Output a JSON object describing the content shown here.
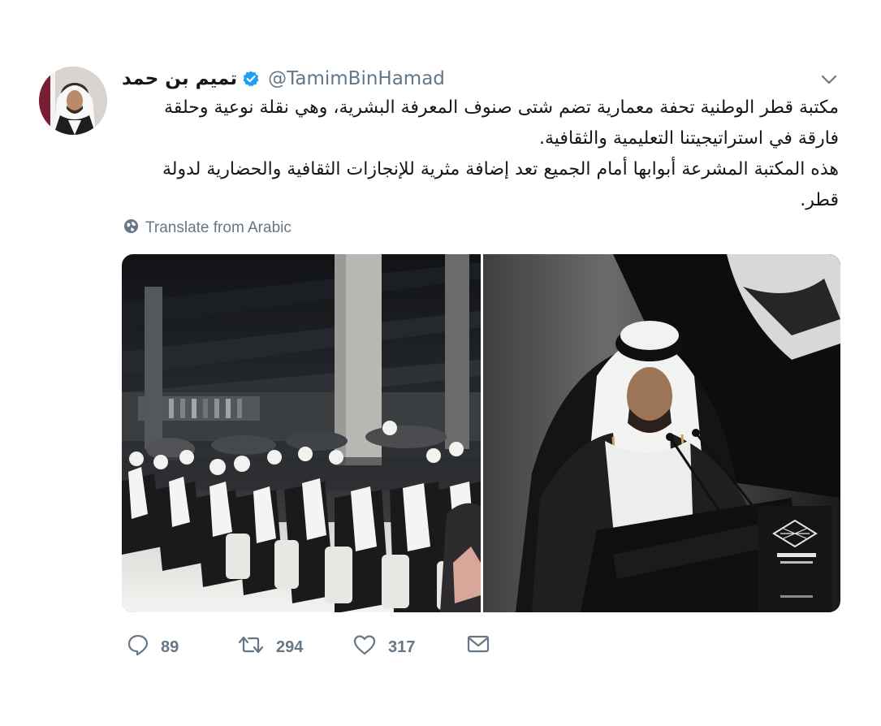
{
  "author": {
    "display_name": "تميم بن حمد",
    "handle": "@TamimBinHamad",
    "verified": true,
    "verified_color": "#1da1f2"
  },
  "tweet": {
    "paragraph_1": "مكتبة قطر الوطنية تحفة معمارية تضم شتى صنوف المعرفة البشرية، وهي نقلة نوعية وحلقة فارقة في استراتيجيتنا التعليمية والثقافية.",
    "paragraph_2": "هذه المكتبة المشرعة أبوابها أمام الجميع تعد إضافة مثرية للإنجازات الثقافية والحضارية لدولة قطر.",
    "translate_label": "Translate from Arabic"
  },
  "actions": {
    "reply_count": "89",
    "retweet_count": "294",
    "like_count": "317"
  },
  "icons": {
    "caret": "chevron-down-icon",
    "globe": "globe-icon",
    "reply": "reply-icon",
    "retweet": "retweet-icon",
    "like": "heart-icon",
    "dm": "envelope-icon"
  },
  "colors": {
    "text": "#14171a",
    "secondary": "#657786",
    "brand": "#1da1f2"
  }
}
